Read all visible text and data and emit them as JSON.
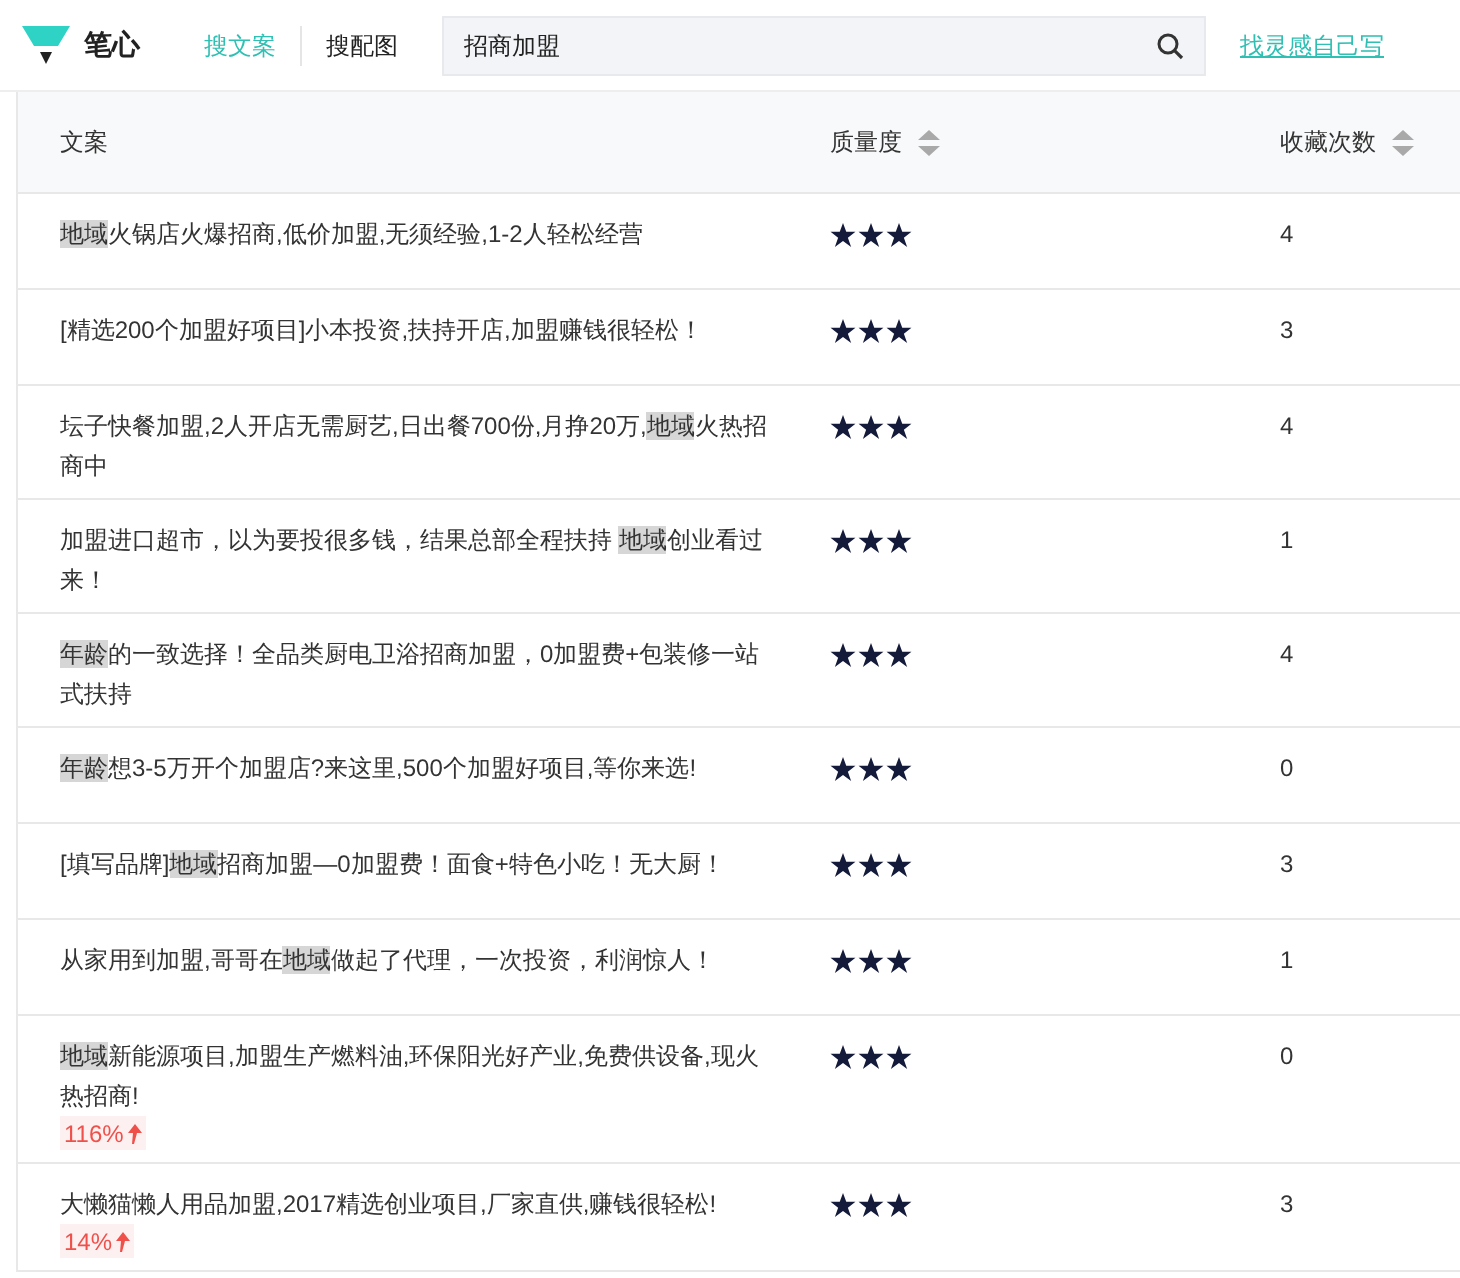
{
  "brand": {
    "name": "笔心"
  },
  "nav_tabs": [
    {
      "label": "搜文案",
      "selected": true
    },
    {
      "label": "搜配图",
      "selected": false
    }
  ],
  "search": {
    "value": "招商加盟"
  },
  "inspire_link": "找灵感自己写",
  "table": {
    "columns": [
      {
        "label": "文案",
        "sortable": false
      },
      {
        "label": "质量度",
        "sortable": true
      },
      {
        "label": "收藏次数",
        "sortable": true
      }
    ],
    "rows": [
      {
        "text": [
          {
            "t": "地域",
            "hl": true
          },
          {
            "t": "火锅店火爆招商,低价加盟,无须经验,1-2人轻松经营",
            "hl": false
          }
        ],
        "stars": 3,
        "count": "4"
      },
      {
        "text": [
          {
            "t": "[精选200个加盟好项目]小本投资,扶持开店,加盟赚钱很轻松！",
            "hl": false
          }
        ],
        "stars": 3,
        "count": "3"
      },
      {
        "text": [
          {
            "t": "坛子快餐加盟,2人开店无需厨艺,日出餐700份,月挣20万,",
            "hl": false
          },
          {
            "t": "地域",
            "hl": true
          },
          {
            "t": "火热招商中",
            "hl": false
          }
        ],
        "stars": 3,
        "count": "4"
      },
      {
        "text": [
          {
            "t": "加盟进口超市，以为要投很多钱，结果总部全程扶持 ",
            "hl": false
          },
          {
            "t": "地域",
            "hl": true
          },
          {
            "t": "创业看过来！",
            "hl": false
          }
        ],
        "stars": 3,
        "count": "1"
      },
      {
        "text": [
          {
            "t": "年龄",
            "hl": true
          },
          {
            "t": "的一致选择！全品类厨电卫浴招商加盟，0加盟费+包装修一站式扶持",
            "hl": false
          }
        ],
        "stars": 3,
        "count": "4"
      },
      {
        "text": [
          {
            "t": "年龄",
            "hl": true
          },
          {
            "t": "想3-5万开个加盟店?来这里,500个加盟好项目,等你来选!",
            "hl": false
          }
        ],
        "stars": 3,
        "count": "0"
      },
      {
        "text": [
          {
            "t": "[填写品牌]",
            "hl": false
          },
          {
            "t": "地域",
            "hl": true
          },
          {
            "t": "招商加盟—0加盟费！面食+特色小吃！无大厨！",
            "hl": false
          }
        ],
        "stars": 3,
        "count": "3"
      },
      {
        "text": [
          {
            "t": "从家用到加盟,哥哥在",
            "hl": false
          },
          {
            "t": "地域",
            "hl": true
          },
          {
            "t": "做起了代理，一次投资，利润惊人！",
            "hl": false
          }
        ],
        "stars": 3,
        "count": "1"
      },
      {
        "text": [
          {
            "t": "地域",
            "hl": true
          },
          {
            "t": "新能源项目,加盟生产燃料油,环保阳光好产业,免费供设备,现火热招商!",
            "hl": false
          }
        ],
        "trend": "116%",
        "stars": 3,
        "count": "0"
      },
      {
        "text": [
          {
            "t": "大懒猫懒人用品加盟,2017精选创业项目,厂家直供,赚钱很轻松!",
            "hl": false
          }
        ],
        "trend": "14%",
        "stars": 3,
        "count": "3"
      }
    ]
  }
}
